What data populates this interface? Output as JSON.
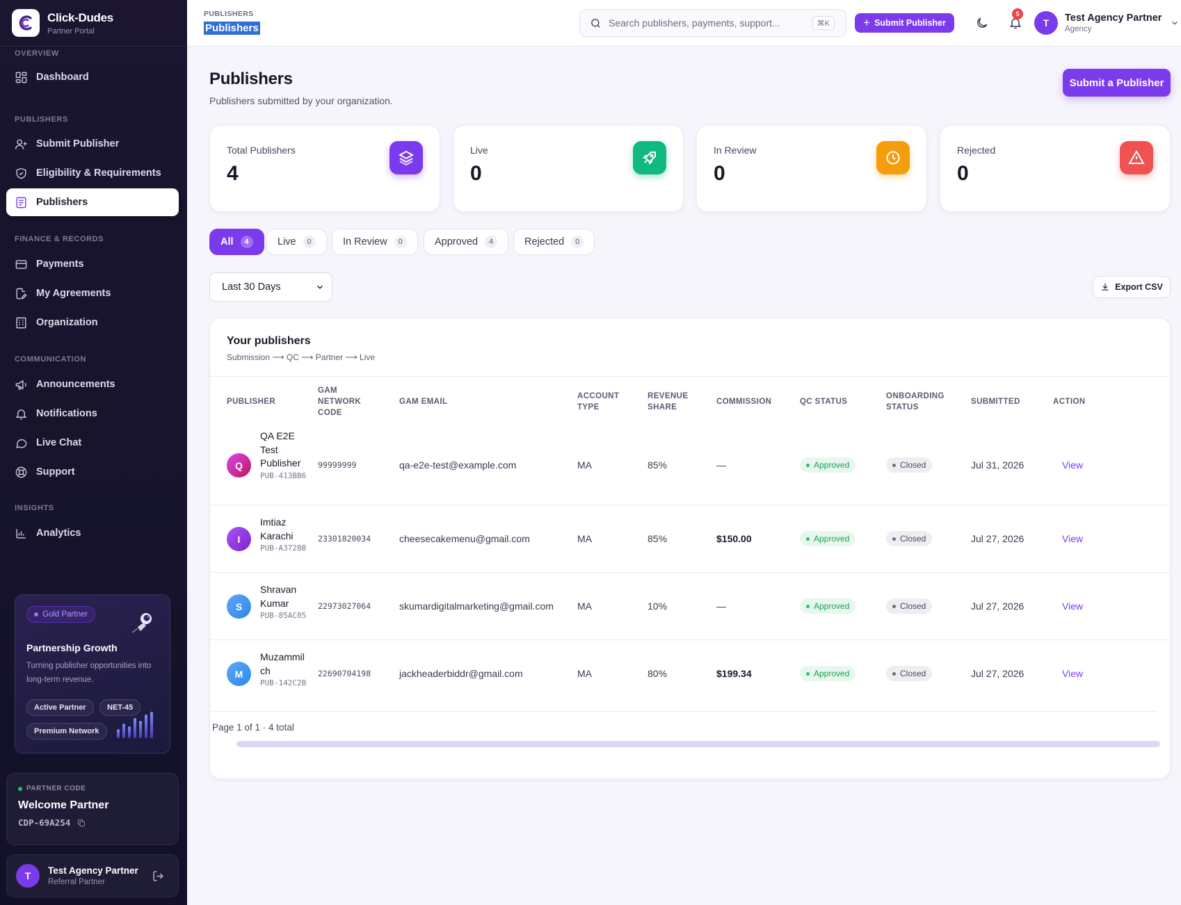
{
  "brand": {
    "name": "Click-Dudes",
    "subtitle": "Partner Portal"
  },
  "sidebar": {
    "sections": [
      {
        "title": "OVERVIEW"
      },
      {
        "title": "PUBLISHERS"
      },
      {
        "title": "FINANCE & RECORDS"
      },
      {
        "title": "COMMUNICATION"
      },
      {
        "title": "INSIGHTS"
      }
    ],
    "items": [
      {
        "label": "Dashboard",
        "icon": "dashboard-icon"
      },
      {
        "label": "Submit Publisher",
        "icon": "user-plus-icon"
      },
      {
        "label": "Eligibility & Requirements",
        "icon": "shield-check-icon"
      },
      {
        "label": "Publishers",
        "icon": "newspaper-icon",
        "active": true
      },
      {
        "label": "Payments",
        "icon": "credit-card-icon"
      },
      {
        "label": "My Agreements",
        "icon": "file-edit-icon"
      },
      {
        "label": "Organization",
        "icon": "building-icon"
      },
      {
        "label": "Announcements",
        "icon": "megaphone-icon"
      },
      {
        "label": "Notifications",
        "icon": "bell-icon"
      },
      {
        "label": "Live Chat",
        "icon": "chat-bubble-icon"
      },
      {
        "label": "Support",
        "icon": "lifebuoy-icon"
      },
      {
        "label": "Analytics",
        "icon": "bar-chart-icon"
      }
    ],
    "promo": {
      "badge": "Gold Partner",
      "title": "Partnership Growth",
      "description": "Turning publisher opportunities into long-term revenue.",
      "pills": [
        "Active Partner",
        "NET-45",
        "Premium Network"
      ],
      "bar_levels": [
        0.35,
        0.55,
        0.45,
        0.75,
        0.65,
        0.9,
        1.0
      ]
    },
    "partner_code": {
      "label": "PARTNER CODE",
      "welcome": "Welcome Partner",
      "code": "CDP-69A254"
    },
    "user": {
      "initial": "T",
      "name": "Test Agency Partner",
      "role": "Referral Partner"
    }
  },
  "topbar": {
    "breadcrumb_section": "PUBLISHERS",
    "breadcrumb_page": "Publishers",
    "search_placeholder": "Search publishers, payments, support...",
    "search_shortcut": "⌘K",
    "submit_button": "Submit Publisher",
    "notification_count": "5",
    "user": {
      "initial": "T",
      "name": "Test Agency Partner",
      "role": "Agency"
    }
  },
  "page": {
    "title": "Publishers",
    "subtitle": "Publishers submitted by your organization.",
    "primary_button": "Submit a Publisher"
  },
  "stats": [
    {
      "label": "Total Publishers",
      "value": "4",
      "color": "#7c3aed",
      "icon": "layers-icon"
    },
    {
      "label": "Live",
      "value": "0",
      "color": "#10b981",
      "icon": "rocket-icon"
    },
    {
      "label": "In Review",
      "value": "0",
      "color": "#f59e0b",
      "icon": "clock-icon"
    },
    {
      "label": "Rejected",
      "value": "0",
      "color": "#ef4444",
      "icon": "alert-triangle-icon"
    }
  ],
  "tabs": [
    {
      "label": "All",
      "count": "4",
      "active": true
    },
    {
      "label": "Live",
      "count": "0"
    },
    {
      "label": "In Review",
      "count": "0"
    },
    {
      "label": "Approved",
      "count": "4"
    },
    {
      "label": "Rejected",
      "count": "0"
    }
  ],
  "filter": {
    "date_range": "Last 30 Days",
    "export_label": "Export CSV"
  },
  "table": {
    "title": "Your publishers",
    "subtitle": "Submission ⟶ QC ⟶ Partner ⟶ Live",
    "columns": [
      "PUBLISHER",
      "GAM NETWORK CODE",
      "GAM EMAIL",
      "ACCOUNT TYPE",
      "REVENUE SHARE",
      "COMMISSION",
      "QC STATUS",
      "ONBOARDING STATUS",
      "SUBMITTED",
      "ACTION"
    ],
    "rows": [
      {
        "initial": "Q",
        "avatar_color": "#c026d3",
        "name": "QA E2E Test Publisher",
        "id": "PUB-413BB6",
        "network_code": "99999999",
        "email": "qa-e2e-test@example.com",
        "account_type": "MA",
        "revenue_share": "85%",
        "commission": "—",
        "qc_status": "Approved",
        "onboarding_status": "Closed",
        "submitted": "Jul 31, 2026",
        "action": "View"
      },
      {
        "initial": "I",
        "avatar_color": "#9333ea",
        "name": "Imtiaz Karachi",
        "id": "PUB-A3728B",
        "network_code": "23301820034",
        "email": "cheesecakemenu@gmail.com",
        "account_type": "MA",
        "revenue_share": "85%",
        "commission": "$150.00",
        "qc_status": "Approved",
        "onboarding_status": "Closed",
        "submitted": "Jul 27, 2026",
        "action": "View"
      },
      {
        "initial": "S",
        "avatar_color": "#3b9af0",
        "name": "Shravan Kumar",
        "id": "PUB-85AC05",
        "network_code": "22973027064",
        "email": "skumardigitalmarketing@gmail.com",
        "account_type": "MA",
        "revenue_share": "10%",
        "commission": "—",
        "qc_status": "Approved",
        "onboarding_status": "Closed",
        "submitted": "Jul 27, 2026",
        "action": "View"
      },
      {
        "initial": "M",
        "avatar_color": "#3b9af0",
        "name": "Muzammil ch",
        "id": "PUB-142C2B",
        "network_code": "22690704198",
        "email": "jackheaderbiddr@gmail.com",
        "account_type": "MA",
        "revenue_share": "80%",
        "commission": "$199.34",
        "qc_status": "Approved",
        "onboarding_status": "Closed",
        "submitted": "Jul 27, 2026",
        "action": "View"
      }
    ],
    "pagination": "Page 1 of 1 · 4 total"
  }
}
